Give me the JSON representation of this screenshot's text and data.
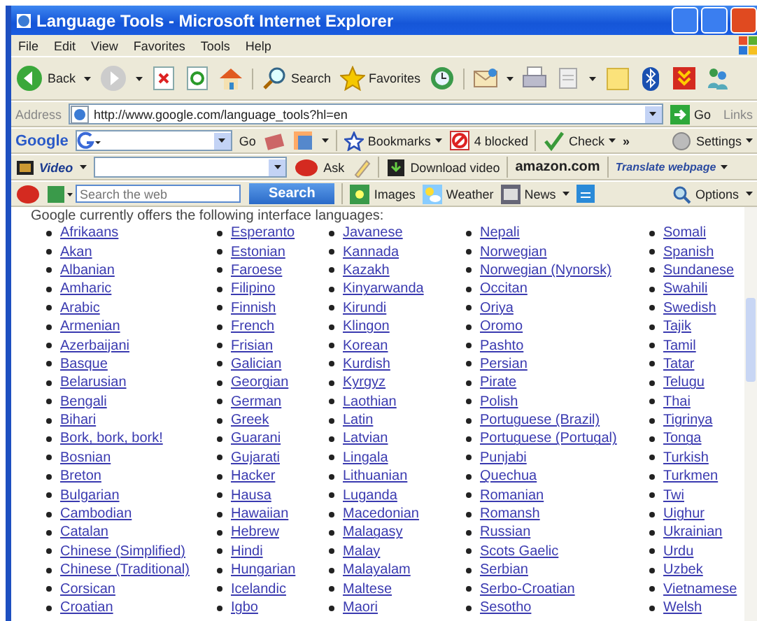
{
  "window": {
    "title": "Language Tools - Microsoft Internet Explorer"
  },
  "menu": [
    "File",
    "Edit",
    "View",
    "Favorites",
    "Tools",
    "Help"
  ],
  "toolbar": {
    "back": "Back",
    "search": "Search",
    "favorites": "Favorites"
  },
  "address_bar": {
    "label": "Address",
    "url": "http://www.google.com/language_tools?hl=en",
    "go": "Go",
    "links": "Links"
  },
  "google_toolbar": {
    "logo": "Google",
    "go": "Go",
    "bookmarks": "Bookmarks",
    "blocked": "4 blocked",
    "check": "Check",
    "more": "»",
    "settings": "Settings"
  },
  "video_toolbar": {
    "video": "Video",
    "ask": "Ask",
    "download": "Download video",
    "amazon": "amazon.com",
    "translate": "Translate webpage"
  },
  "ask_toolbar": {
    "placeholder": "Search the web",
    "search": "Search",
    "images": "Images",
    "weather": "Weather",
    "news": "News",
    "options": "Options"
  },
  "page": {
    "intro": "Google currently offers the following interface languages:",
    "columns": [
      [
        "Afrikaans",
        "Akan",
        "Albanian",
        "Amharic",
        "Arabic",
        "Armenian",
        "Azerbaijani",
        "Basque",
        "Belarusian",
        "Bengali",
        "Bihari",
        "Bork, bork, bork!",
        "Bosnian",
        "Breton",
        "Bulgarian",
        "Cambodian",
        "Catalan",
        "Chinese (Simplified)",
        "Chinese (Traditional)",
        "Corsican",
        "Croatian"
      ],
      [
        "Esperanto",
        "Estonian",
        "Faroese",
        "Filipino",
        "Finnish",
        "French",
        "Frisian",
        "Galician",
        "Georgian",
        "German",
        "Greek",
        "Guarani",
        "Gujarati",
        "Hacker",
        "Hausa",
        "Hawaiian",
        "Hebrew",
        "Hindi",
        "Hungarian",
        "Icelandic",
        "Igbo"
      ],
      [
        "Javanese",
        "Kannada",
        "Kazakh",
        "Kinyarwanda",
        "Kirundi",
        "Klingon",
        "Korean",
        "Kurdish",
        "Kyrgyz",
        "Laothian",
        "Latin",
        "Latvian",
        "Lingala",
        "Lithuanian",
        "Luganda",
        "Macedonian",
        "Malagasy",
        "Malay",
        "Malayalam",
        "Maltese",
        "Maori"
      ],
      [
        "Nepali",
        "Norwegian",
        "Norwegian (Nynorsk)",
        "Occitan",
        "Oriya",
        "Oromo",
        "Pashto",
        "Persian",
        "Pirate",
        "Polish",
        "Portuguese (Brazil)",
        "Portuguese (Portugal)",
        "Punjabi",
        "Quechua",
        "Romanian",
        "Romansh",
        "Russian",
        "Scots Gaelic",
        "Serbian",
        "Serbo-Croatian",
        "Sesotho"
      ],
      [
        "Somali",
        "Spanish",
        "Sundanese",
        "Swahili",
        "Swedish",
        "Tajik",
        "Tamil",
        "Tatar",
        "Telugu",
        "Thai",
        "Tigrinya",
        "Tonga",
        "Turkish",
        "Turkmen",
        "Twi",
        "Uighur",
        "Ukrainian",
        "Urdu",
        "Uzbek",
        "Vietnamese",
        "Welsh"
      ]
    ]
  }
}
